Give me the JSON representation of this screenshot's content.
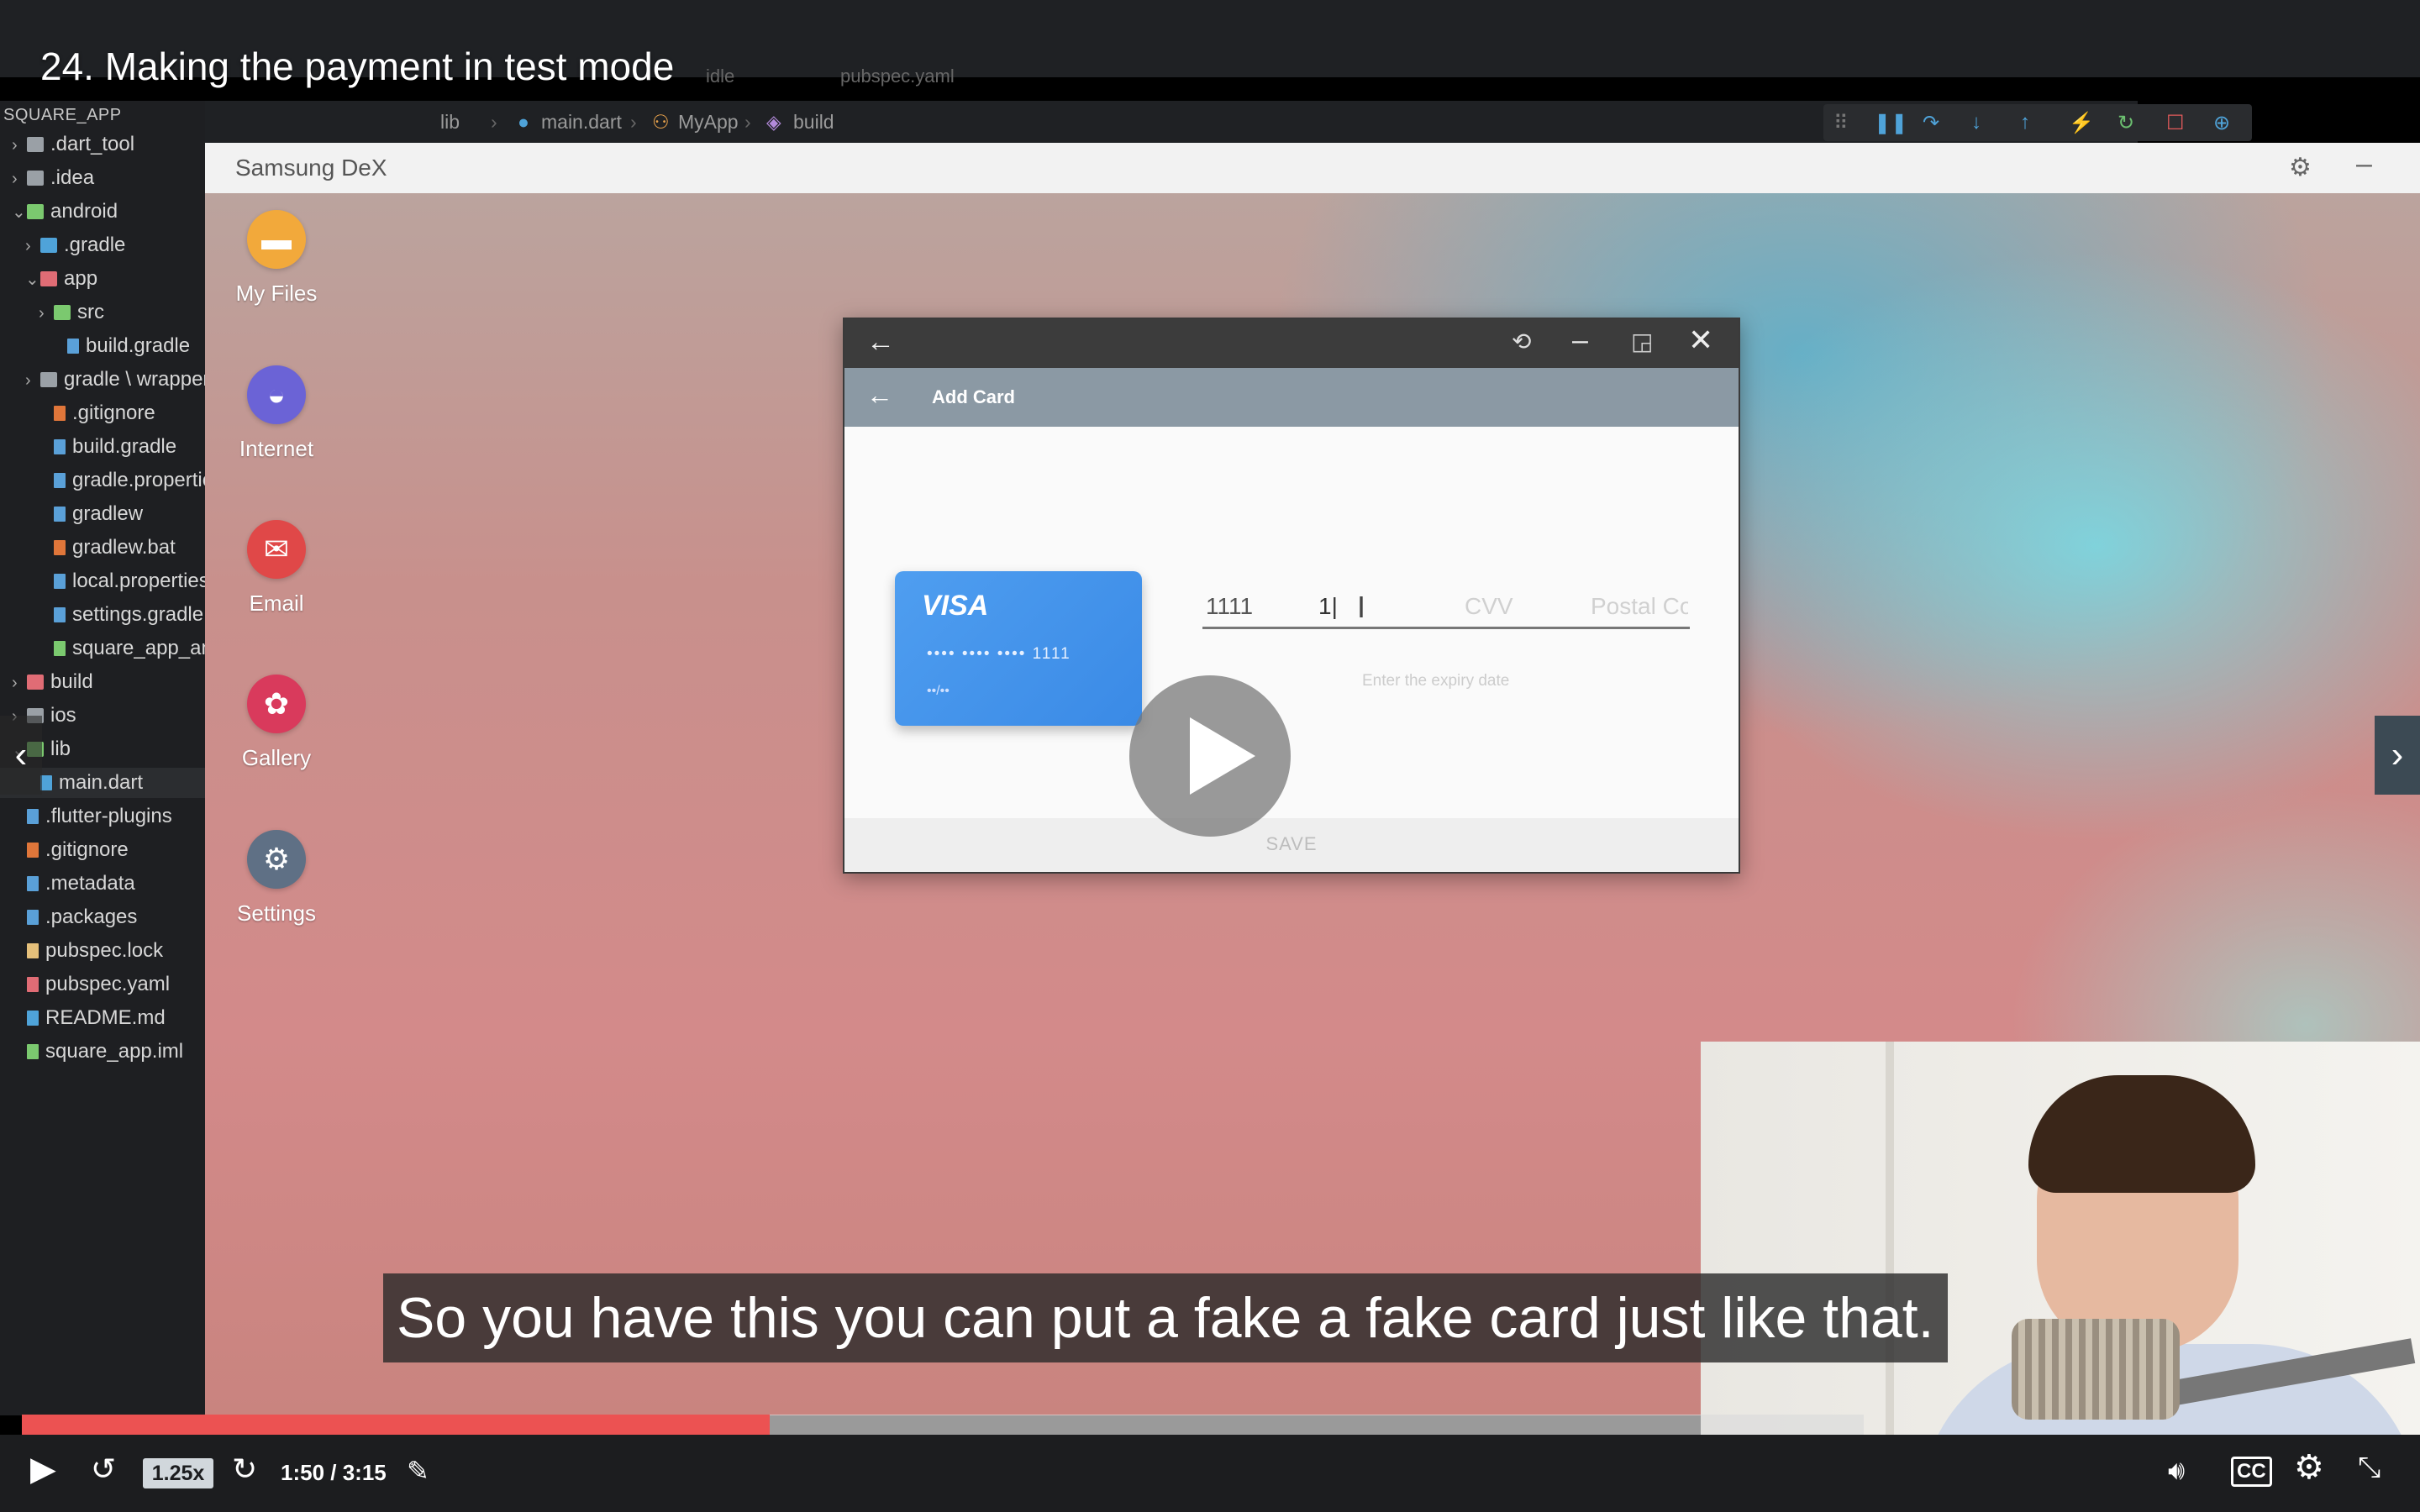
{
  "player": {
    "lecture_title": "24. Making the payment in test mode",
    "caption": "So you have this you can put a fake a fake card just like that.",
    "speed": "1.25x",
    "time": "1:50 / 3:15",
    "progress_fraction": 0.406,
    "prev_icon": "chevron-left-icon",
    "next_icon": "chevron-right-icon"
  },
  "ide": {
    "tabs": [
      "idle",
      "pubspec.yaml"
    ],
    "explorer_title": "SQUARE_APP",
    "breadcrumb": [
      "lib",
      "main.dart",
      "MyApp",
      "build"
    ],
    "tree": [
      {
        "label": ".dart_tool",
        "depth": 0,
        "chev": "›",
        "icon": "folder",
        "color": "#9aa0a6"
      },
      {
        "label": ".idea",
        "depth": 0,
        "chev": "›",
        "icon": "folder",
        "color": "#9aa0a6"
      },
      {
        "label": "android",
        "depth": 0,
        "chev": "⌄",
        "icon": "folder",
        "color": "#7bc96f"
      },
      {
        "label": ".gradle",
        "depth": 1,
        "chev": "›",
        "icon": "folder",
        "color": "#4fa3d9"
      },
      {
        "label": "app",
        "depth": 1,
        "chev": "⌄",
        "icon": "folder",
        "color": "#e06c75"
      },
      {
        "label": "src",
        "depth": 2,
        "chev": "›",
        "icon": "folder",
        "color": "#7bc96f"
      },
      {
        "label": "build.gradle",
        "depth": 3,
        "chev": "",
        "icon": "file",
        "color": "#5aa0d8"
      },
      {
        "label": "gradle \\ wrapper",
        "depth": 1,
        "chev": "›",
        "icon": "folder",
        "color": "#9aa0a6"
      },
      {
        "label": ".gitignore",
        "depth": 2,
        "chev": "",
        "icon": "file",
        "color": "#e0763a"
      },
      {
        "label": "build.gradle",
        "depth": 2,
        "chev": "",
        "icon": "file",
        "color": "#5aa0d8"
      },
      {
        "label": "gradle.properties",
        "depth": 2,
        "chev": "",
        "icon": "file",
        "color": "#5aa0d8"
      },
      {
        "label": "gradlew",
        "depth": 2,
        "chev": "",
        "icon": "file",
        "color": "#5aa0d8"
      },
      {
        "label": "gradlew.bat",
        "depth": 2,
        "chev": "",
        "icon": "file",
        "color": "#e0763a"
      },
      {
        "label": "local.properties",
        "depth": 2,
        "chev": "",
        "icon": "file",
        "color": "#5aa0d8"
      },
      {
        "label": "settings.gradle",
        "depth": 2,
        "chev": "",
        "icon": "file",
        "color": "#5aa0d8"
      },
      {
        "label": "square_app_android.iml",
        "depth": 2,
        "chev": "",
        "icon": "file",
        "color": "#7bc96f"
      },
      {
        "label": "build",
        "depth": 0,
        "chev": "›",
        "icon": "folder",
        "color": "#e06c75"
      },
      {
        "label": "ios",
        "depth": 0,
        "chev": "›",
        "icon": "folder",
        "color": "#9aa0a6"
      },
      {
        "label": "lib",
        "depth": 0,
        "chev": "⌄",
        "icon": "folder",
        "color": "#7bc96f"
      },
      {
        "label": "main.dart",
        "depth": 1,
        "chev": "",
        "icon": "file",
        "color": "#4fa3d9",
        "selected": true
      },
      {
        "label": ".flutter-plugins",
        "depth": 0,
        "chev": "",
        "icon": "file",
        "color": "#5aa0d8"
      },
      {
        "label": ".gitignore",
        "depth": 0,
        "chev": "",
        "icon": "file",
        "color": "#e0763a"
      },
      {
        "label": ".metadata",
        "depth": 0,
        "chev": "",
        "icon": "file",
        "color": "#5aa0d8"
      },
      {
        "label": ".packages",
        "depth": 0,
        "chev": "",
        "icon": "file",
        "color": "#5aa0d8"
      },
      {
        "label": "pubspec.lock",
        "depth": 0,
        "chev": "",
        "icon": "file",
        "color": "#e5c07b"
      },
      {
        "label": "pubspec.yaml",
        "depth": 0,
        "chev": "",
        "icon": "file",
        "color": "#e06c75"
      },
      {
        "label": "README.md",
        "depth": 0,
        "chev": "",
        "icon": "file",
        "color": "#4fa3d9"
      },
      {
        "label": "square_app.iml",
        "depth": 0,
        "chev": "",
        "icon": "file",
        "color": "#7bc96f"
      }
    ]
  },
  "dex": {
    "window_title": "Samsung DeX",
    "apps": [
      {
        "label": "My Files",
        "icon": "folder-icon",
        "glyph": "▬",
        "color": "#f2a93b"
      },
      {
        "label": "Internet",
        "icon": "planet-icon",
        "glyph": "◒",
        "color": "#6b63d6"
      },
      {
        "label": "Email",
        "icon": "mail-icon",
        "glyph": "✉",
        "color": "#e04848"
      },
      {
        "label": "Gallery",
        "icon": "flower-icon",
        "glyph": "✿",
        "color": "#d93a5c"
      },
      {
        "label": "Settings",
        "icon": "gear-icon",
        "glyph": "⚙",
        "color": "#5f7085"
      }
    ]
  },
  "add_card": {
    "appbar_title": "Add Card",
    "card_brand": "VISA",
    "card_number_masked": "•••• •••• •••• 1111",
    "card_expiry_placeholder": "••/••",
    "card_number_tail": "1111",
    "expiry_value": "1|",
    "cvv_placeholder": "CVV",
    "postal_placeholder": "Postal Co",
    "expiry_hint": "Enter the expiry date",
    "save_label": "SAVE"
  },
  "colors": {
    "progress": "#ec5252",
    "controls_bg": "#1c1d1f",
    "visa_blue": "#4a98ee"
  }
}
